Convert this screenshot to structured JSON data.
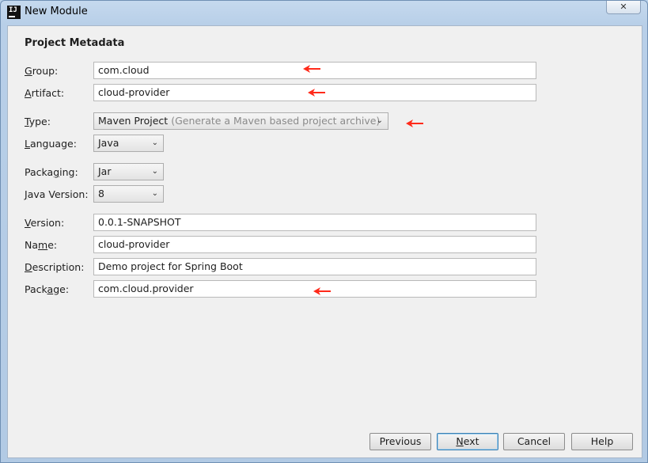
{
  "window": {
    "title": "New Module",
    "close_symbol": "✕",
    "app_icon_text": "IJ"
  },
  "section_title": "Project Metadata",
  "form": {
    "group": {
      "label_u": "G",
      "label_rest": "roup:",
      "value": "com.cloud"
    },
    "artifact": {
      "label_u": "A",
      "label_rest": "rtifact:",
      "value": "cloud-provider"
    },
    "type": {
      "label_u": "T",
      "label_rest": "ype:",
      "value": "Maven Project",
      "hint": "(Generate a Maven based project archive)"
    },
    "language": {
      "label_pre": "",
      "label_u": "L",
      "label_rest": "anguage:",
      "value": "Java"
    },
    "packaging": {
      "label_pre": "Packa",
      "label_u": "g",
      "label_rest": "ing:",
      "value": "Jar"
    },
    "java_version": {
      "label_u": "J",
      "label_rest": "ava Version:",
      "value": "8"
    },
    "version": {
      "label_u": "V",
      "label_rest": "ersion:",
      "value": "0.0.1-SNAPSHOT"
    },
    "name": {
      "label_pre": "Na",
      "label_u": "m",
      "label_rest": "e:",
      "value": "cloud-provider"
    },
    "description": {
      "label_u": "D",
      "label_rest": "escription:",
      "value": "Demo project for Spring Boot"
    },
    "package": {
      "label_pre": "Pack",
      "label_u": "a",
      "label_rest": "ge:",
      "value": "com.cloud.provider"
    }
  },
  "buttons": {
    "previous": "Previous",
    "next_u": "N",
    "next_rest": "ext",
    "cancel": "Cancel",
    "help": "Help"
  },
  "annotation_color": "#ff2a1a",
  "chevron_glyph": "⌄"
}
